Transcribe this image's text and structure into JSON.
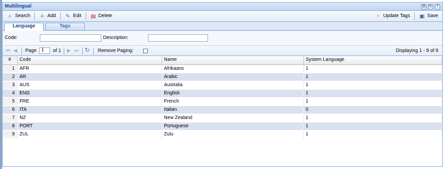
{
  "window": {
    "title": "Multilingual"
  },
  "toolbar": {
    "search_label": "Search",
    "add_label": "Add",
    "edit_label": "Edit",
    "delete_label": "Delete",
    "update_tags_label": "Update Tags",
    "save_label": "Save"
  },
  "tabs": {
    "language": "Language",
    "tags": "Tags"
  },
  "form": {
    "code_label": "Code:",
    "code_value": "",
    "description_label": "Description:",
    "description_value": ""
  },
  "pager": {
    "page_label": "Page",
    "page_value": "1",
    "of_label": "of 1",
    "remove_paging_label": "Remove Paging:",
    "display_text": "Displaying 1 - 9 of 9"
  },
  "grid": {
    "headers": {
      "num": "#",
      "code": "Code",
      "name": "Name",
      "system": "System Language"
    },
    "rows": [
      {
        "num": "1",
        "code": "AFR",
        "name": "Afrikaans",
        "system": "1"
      },
      {
        "num": "2",
        "code": "AR",
        "name": "Arabic",
        "system": "1"
      },
      {
        "num": "3",
        "code": "AUS",
        "name": "Australia",
        "system": "1"
      },
      {
        "num": "4",
        "code": "ENG",
        "name": "English",
        "system": "1"
      },
      {
        "num": "5",
        "code": "FRE",
        "name": "French",
        "system": "1"
      },
      {
        "num": "6",
        "code": "ITA",
        "name": "Italian",
        "system": "0"
      },
      {
        "num": "7",
        "code": "NZ",
        "name": "New Zealand",
        "system": "1"
      },
      {
        "num": "8",
        "code": "PORT",
        "name": "Portuguese",
        "system": "1"
      },
      {
        "num": "9",
        "code": "ZUL",
        "name": "Zulu",
        "system": "1"
      }
    ]
  }
}
